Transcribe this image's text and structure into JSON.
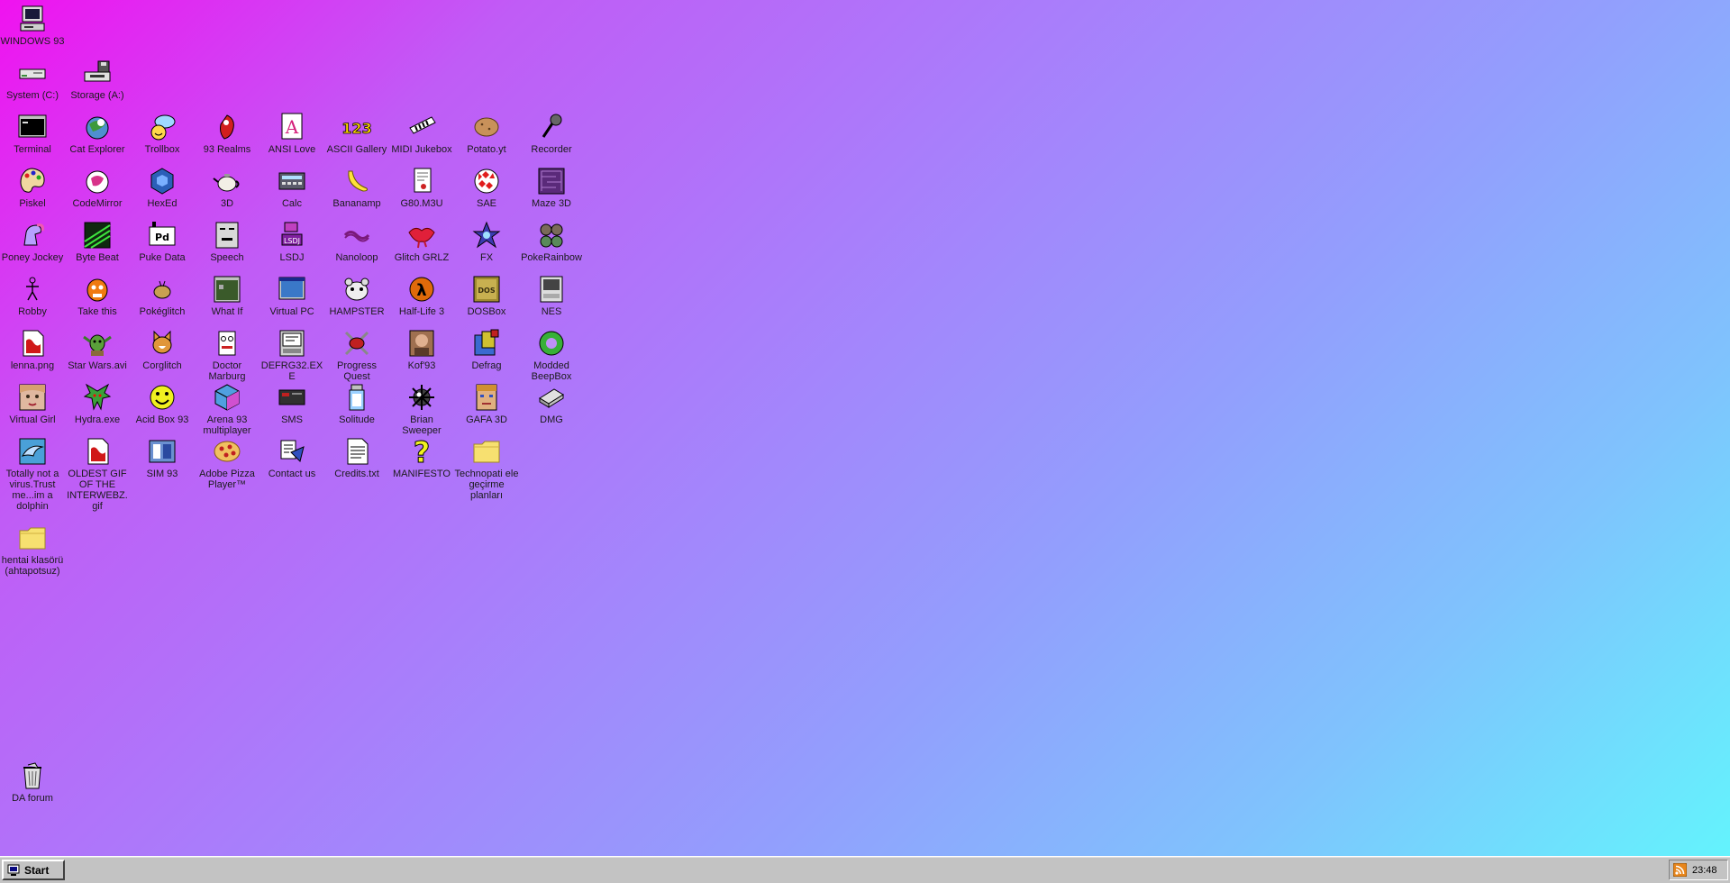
{
  "desktop": {
    "icons": [
      {
        "label": "WINDOWS 93",
        "icon": "computer-icon",
        "col": 0,
        "row": 0
      },
      {
        "label": "System (C:)",
        "icon": "hard-drive-icon",
        "col": 0,
        "row": 1
      },
      {
        "label": "Storage (A:)",
        "icon": "floppy-drive-icon",
        "col": 1,
        "row": 1
      },
      {
        "label": "Terminal",
        "icon": "terminal-icon",
        "col": 0,
        "row": 2
      },
      {
        "label": "Cat Explorer",
        "icon": "cat-explorer-icon",
        "col": 1,
        "row": 2
      },
      {
        "label": "Trollbox",
        "icon": "trollbox-icon",
        "col": 2,
        "row": 2
      },
      {
        "label": "93 Realms",
        "icon": "realms-icon",
        "col": 3,
        "row": 2
      },
      {
        "label": "ANSI Love",
        "icon": "ansi-love-icon",
        "col": 4,
        "row": 2
      },
      {
        "label": "ASCII Gallery",
        "icon": "ascii-gallery-icon",
        "col": 5,
        "row": 2
      },
      {
        "label": "MIDI Jukebox",
        "icon": "midi-jukebox-icon",
        "col": 6,
        "row": 2
      },
      {
        "label": "Potato.yt",
        "icon": "potato-icon",
        "col": 7,
        "row": 2
      },
      {
        "label": "Recorder",
        "icon": "microphone-icon",
        "col": 8,
        "row": 2
      },
      {
        "label": "Piskel",
        "icon": "palette-icon",
        "col": 0,
        "row": 3
      },
      {
        "label": "CodeMirror",
        "icon": "codemirror-icon",
        "col": 1,
        "row": 3
      },
      {
        "label": "HexEd",
        "icon": "hexagon-cube-icon",
        "col": 2,
        "row": 3
      },
      {
        "label": "3D",
        "icon": "teapot-icon",
        "col": 3,
        "row": 3
      },
      {
        "label": "Calc",
        "icon": "calculator-icon",
        "col": 4,
        "row": 3
      },
      {
        "label": "Bananamp",
        "icon": "banana-icon",
        "col": 5,
        "row": 3
      },
      {
        "label": "G80.M3U",
        "icon": "playlist-icon",
        "col": 6,
        "row": 3
      },
      {
        "label": "SAE",
        "icon": "amiga-ball-icon",
        "col": 7,
        "row": 3
      },
      {
        "label": "Maze 3D",
        "icon": "maze-icon",
        "col": 8,
        "row": 3
      },
      {
        "label": "Poney Jockey",
        "icon": "pony-icon",
        "col": 0,
        "row": 4
      },
      {
        "label": "Byte Beat",
        "icon": "byte-beat-icon",
        "col": 1,
        "row": 4
      },
      {
        "label": "Puke Data",
        "icon": "puke-data-icon",
        "col": 2,
        "row": 4
      },
      {
        "label": "Speech",
        "icon": "speech-face-icon",
        "col": 3,
        "row": 4
      },
      {
        "label": "LSDJ",
        "icon": "lsdj-icon",
        "col": 4,
        "row": 4
      },
      {
        "label": "Nanoloop",
        "icon": "nanoloop-icon",
        "col": 5,
        "row": 4
      },
      {
        "label": "Glitch GRLZ",
        "icon": "lips-icon",
        "col": 6,
        "row": 4
      },
      {
        "label": "FX",
        "icon": "fx-star-icon",
        "col": 7,
        "row": 4
      },
      {
        "label": "PokeRainbow",
        "icon": "pokerainbow-icon",
        "col": 8,
        "row": 4
      },
      {
        "label": "Robby",
        "icon": "stick-figure-icon",
        "col": 0,
        "row": 5
      },
      {
        "label": "Take this",
        "icon": "take-this-icon",
        "col": 1,
        "row": 5
      },
      {
        "label": "Pokéglitch",
        "icon": "pokeglitch-icon",
        "col": 2,
        "row": 5
      },
      {
        "label": "What If",
        "icon": "what-if-icon",
        "col": 3,
        "row": 5
      },
      {
        "label": "Virtual PC",
        "icon": "virtual-pc-icon",
        "col": 4,
        "row": 5
      },
      {
        "label": "HAMPSTER",
        "icon": "hamster-icon",
        "col": 5,
        "row": 5
      },
      {
        "label": "Half-Life 3",
        "icon": "half-life-icon",
        "col": 6,
        "row": 5
      },
      {
        "label": "DOSBox",
        "icon": "dosbox-icon",
        "col": 7,
        "row": 5
      },
      {
        "label": "NES",
        "icon": "nes-icon",
        "col": 8,
        "row": 5
      },
      {
        "label": "lenna.png",
        "icon": "image-file-icon",
        "col": 0,
        "row": 6
      },
      {
        "label": "Star Wars.avi",
        "icon": "yoda-icon",
        "col": 1,
        "row": 6
      },
      {
        "label": "Corglitch",
        "icon": "corgi-icon",
        "col": 2,
        "row": 6
      },
      {
        "label": "Doctor Marburg",
        "icon": "doctor-icon",
        "col": 3,
        "row": 6
      },
      {
        "label": "DEFRG32.EXE",
        "icon": "defrg-icon",
        "col": 4,
        "row": 6
      },
      {
        "label": "Progress Quest",
        "icon": "progress-quest-icon",
        "col": 5,
        "row": 6
      },
      {
        "label": "Kof'93",
        "icon": "kof-icon",
        "col": 6,
        "row": 6
      },
      {
        "label": "Defrag",
        "icon": "defrag-icon",
        "col": 7,
        "row": 6
      },
      {
        "label": "Modded BeepBox",
        "icon": "beepbox-icon",
        "col": 8,
        "row": 6
      },
      {
        "label": "Virtual Girl",
        "icon": "virtual-girl-icon",
        "col": 0,
        "row": 7
      },
      {
        "label": "Hydra.exe",
        "icon": "hydra-icon",
        "col": 1,
        "row": 7
      },
      {
        "label": "Acid Box 93",
        "icon": "smiley-icon",
        "col": 2,
        "row": 7
      },
      {
        "label": "Arena 93 multiplayer",
        "icon": "cube-icon",
        "col": 3,
        "row": 7
      },
      {
        "label": "SMS",
        "icon": "sms-icon",
        "col": 4,
        "row": 7
      },
      {
        "label": "Solitude",
        "icon": "solitude-icon",
        "col": 5,
        "row": 7
      },
      {
        "label": "Brian Sweeper",
        "icon": "mine-icon",
        "col": 6,
        "row": 7
      },
      {
        "label": "GAFA 3D",
        "icon": "gafa-face-icon",
        "col": 7,
        "row": 7
      },
      {
        "label": "DMG",
        "icon": "dmg-icon",
        "col": 8,
        "row": 7
      },
      {
        "label": "Totally not a virus.Trust me...im a dolphin",
        "icon": "dolphin-icon",
        "col": 0,
        "row": 8
      },
      {
        "label": "OLDEST GIF OF THE INTERWEBZ.gif",
        "icon": "gif-file-icon",
        "col": 1,
        "row": 8
      },
      {
        "label": "SIM 93",
        "icon": "sim-icon",
        "col": 2,
        "row": 8
      },
      {
        "label": "Adobe Pizza Player™",
        "icon": "pizza-icon",
        "col": 3,
        "row": 8
      },
      {
        "label": "Contact us",
        "icon": "contact-icon",
        "col": 4,
        "row": 8
      },
      {
        "label": "Credits.txt",
        "icon": "text-file-icon",
        "col": 5,
        "row": 8
      },
      {
        "label": "MANIFESTO",
        "icon": "question-mark-icon",
        "col": 6,
        "row": 8
      },
      {
        "label": "Technopati ele geçirme planları",
        "icon": "folder-icon",
        "col": 7,
        "row": 8
      },
      {
        "label": "hentai klasörü (ahtapotsuz)",
        "icon": "folder-icon",
        "col": 0,
        "row": 9.6
      },
      {
        "label": "DA forum",
        "icon": "recycle-bin-icon",
        "col": 0,
        "row": 14
      }
    ]
  },
  "taskbar": {
    "start_label": "Start",
    "clock": "23:48",
    "tray_icon": "rss-icon"
  },
  "colors": {
    "background_start": "#f012f0",
    "background_end": "#62f6fd",
    "taskbar": "#c3c3c3"
  }
}
